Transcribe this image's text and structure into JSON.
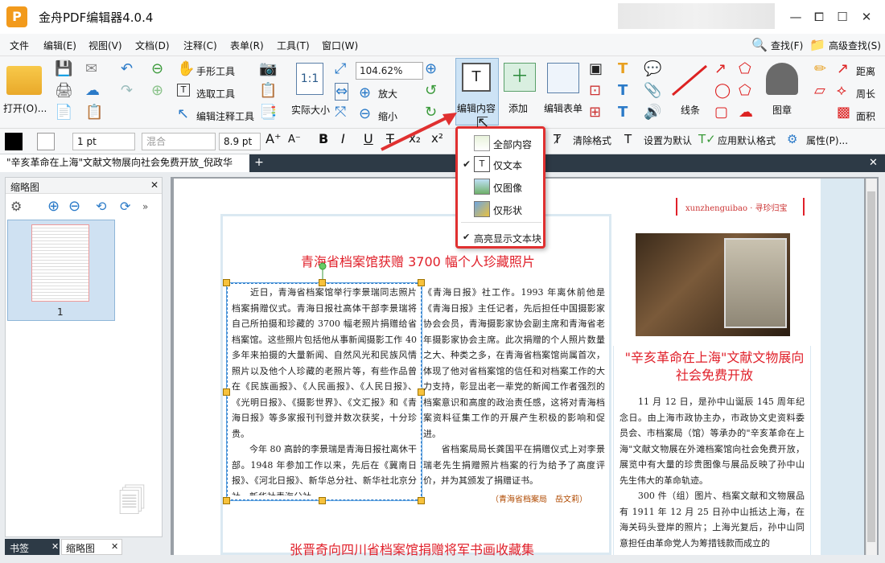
{
  "app": {
    "title": "金舟PDF编辑器4.0.4",
    "logo": "P"
  },
  "window": {
    "minimize": "—",
    "restore": "⧠",
    "maximize": "☐",
    "close": "✕"
  },
  "menu": [
    "文件",
    "编辑(E)",
    "视图(V)",
    "文档(D)",
    "注释(C)",
    "表单(R)",
    "工具(T)",
    "窗口(W)"
  ],
  "search": {
    "find": "查找(F)",
    "advanced": "高级查找(S)"
  },
  "toolbar": {
    "open": "打开(O)...",
    "hand": "手形工具",
    "select": "选取工具",
    "edit_annot": "编辑注释工具",
    "actual_size": "实际大小",
    "zoom": "104.62%",
    "zoom_in": "放大",
    "zoom_out": "缩小",
    "edit_content": "编辑内容",
    "add": "添加",
    "edit_form": "编辑表单",
    "line": "线条",
    "stamp": "图章",
    "distance": "距离",
    "perimeter": "周长",
    "area": "面积"
  },
  "format": {
    "line_width": "1 pt",
    "blend": "混合",
    "font_size": "8.9 pt",
    "clear_format": "清除格式",
    "set_default": "设置为默认",
    "apply_default": "应用默认格式",
    "properties": "属性(P)...",
    "bold": "B",
    "italic": "I",
    "underline": "U",
    "strike": "T",
    "sub": "x₂",
    "sup": "x²"
  },
  "tab": {
    "label": "\"辛亥革命在上海\"文献文物展向社会免费开放_倪政华",
    "add": "+",
    "close": "✕"
  },
  "left": {
    "header": "缩略图",
    "close": "✕",
    "page_number": "1",
    "bottom_tabs": [
      "书签",
      "缩略图"
    ]
  },
  "dropdown": {
    "items": [
      "全部内容",
      "仅文本",
      "仅图像",
      "仅形状"
    ],
    "checked": 1,
    "highlight": "高亮显示文本块"
  },
  "doc": {
    "title1": "青海省档案馆获赠 3700 幅个人珍藏照片",
    "col1": "　　近日，青海省档案馆举行李景瑞同志照片档案捐赠仪式。青海日报社高体干部李景瑞将自己所拍摄和珍藏的 3700 幅老照片捐赠给省档案馆。这些照片包括他从事新闻摄影工作 40 多年来拍摄的大量新闻、自然风光和民族风情照片以及他个人珍藏的老照片等，有些作品曾在《民族画报》、《人民画报》、《人民日报》、《光明日报》、《摄影世界》、《文汇报》和《青海日报》等多家报刊刊登并数次获奖，十分珍贵。\n　　今年 80 高龄的李景瑞是青海日报社离休干部。1948 年参加工作以来，先后在《冀南日报》、《河北日报》、新华总分社、新华社北京分社、新华社青海分社、",
    "col2": "《青海日报》社工作。1993 年离休前他是《青海日报》主任记者，先后担任中国摄影家协会会员，青海摄影家协会副主席和青海省老年摄影家协会主席。此次捐赠的个人照片数量之大、种类之多，在青海省档案馆尚属首次，体现了他对省档案馆的信任和对档案工作的大力支持，彰显出老一辈党的新闻工作者强烈的档案意识和高度的政治责任感，这将对青海档案资料征集工作的开展产生积极的影响和促进。\n　　省档案局局长龚国平在捐赠仪式上对李景瑞老先生捐赠照片档案的行为给予了高度评价，并为其颁发了捐赠证书。",
    "credit": "（青海省档案局　岳文莉）",
    "tag": "xunzhenguibao · 寻珍归宝",
    "title2": "\"辛亥革命在上海\"文献文物展向社会免费开放",
    "col3": "　　11 月 12 日，是孙中山诞辰 145 周年纪念日。由上海市政协主办，市政协文史资料委员会、市档案局（馆）等承办的\"辛亥革命在上海\"文献文物展在外滩档案馆向社会免费开放，展览中有大量的珍贵图像与展品反映了孙中山先生伟大的革命轨迹。\n　　300 件（组）图片、档案文献和文物展品有 1911 年 12 月 25 日孙中山抵达上海，在海关码头登岸的照片；上海光复后，孙中山同意担任由革命党人为筹措钱款而成立的",
    "title3": "张晋奇向四川省档案馆捐赠将军书画收藏集"
  },
  "colors": {
    "accent": "#e0202a",
    "tabbar": "#2d3a46"
  }
}
